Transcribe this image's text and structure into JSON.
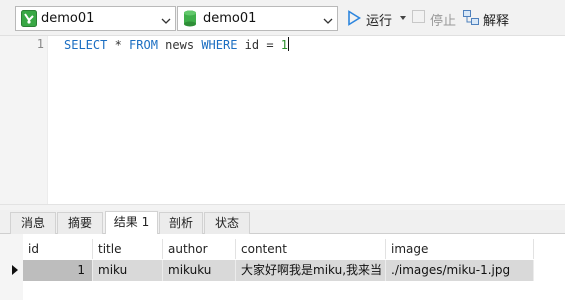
{
  "toolbar": {
    "connection": {
      "value": "demo01",
      "icon": "connection-icon"
    },
    "database": {
      "value": "demo01",
      "icon": "database-icon"
    },
    "run_label": "运行",
    "stop_label": "停止",
    "explain_label": "解释"
  },
  "editor": {
    "line_number": "1",
    "query": {
      "kw1": "SELECT",
      "star": " * ",
      "kw2": "FROM",
      "table": " news ",
      "kw3": "WHERE",
      "cond": " id = ",
      "val": "1"
    }
  },
  "tabs": [
    "消息",
    "摘要",
    "结果 1",
    "剖析",
    "状态"
  ],
  "active_tab": "结果 1",
  "result": {
    "columns": [
      "id",
      "title",
      "author",
      "content",
      "image"
    ],
    "rows": [
      {
        "id": "1",
        "title": "miku",
        "author": "mikuku",
        "content": "大家好啊我是miku,我来当",
        "image": "./images/miku-1.jpg"
      }
    ]
  },
  "colors": {
    "keyword": "#1b6ec2",
    "number": "#2b8f2b",
    "run_accent": "#2e86de"
  }
}
